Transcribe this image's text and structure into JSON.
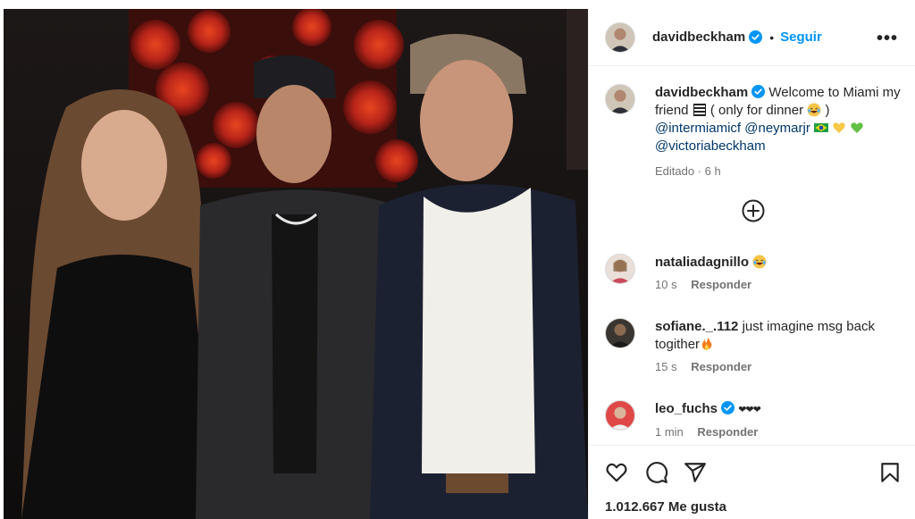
{
  "post": {
    "author": "davidbeckham",
    "follow_label": "Seguir",
    "more_label": "•••"
  },
  "caption": {
    "username": "davidbeckham",
    "text_1": "Welcome to Miami my friend",
    "text_2": "( only for dinner",
    "text_3": ")",
    "mention_1": "@intermiamicf",
    "mention_2": "@neymarjr",
    "mention_3": "@victoriabeckham",
    "edited_label": "Editado",
    "time": "6 h"
  },
  "comments": [
    {
      "username": "nataliadagnillo",
      "text": "",
      "time": "10 s",
      "reply_label": "Responder",
      "verified": false
    },
    {
      "username": "sofiane._.112",
      "text": "just imagine msg back togither",
      "time": "15 s",
      "reply_label": "Responder",
      "verified": false
    },
    {
      "username": "leo_fuchs",
      "text": "❤❤❤",
      "time": "1 min",
      "reply_label": "Responder",
      "verified": true
    }
  ],
  "likes": {
    "label": "1.012.667 Me gusta"
  },
  "icons": {
    "verified": "verified-badge-icon",
    "more": "more-options-icon",
    "load_more": "plus-circle-icon",
    "like": "heart-icon",
    "comment": "comment-icon",
    "share": "share-icon",
    "save": "bookmark-icon"
  },
  "colors": {
    "link_blue": "#0095f6",
    "mention": "#00376b",
    "verified": "#0095f6",
    "secondary_text": "#737373"
  }
}
